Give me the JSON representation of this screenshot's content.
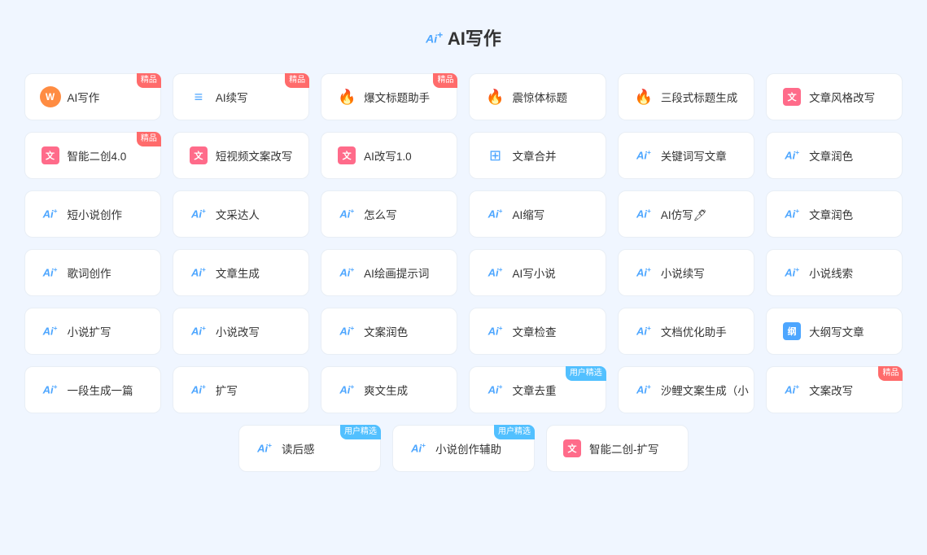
{
  "page": {
    "title": "AI写作",
    "title_prefix": "Ai+"
  },
  "rows": [
    {
      "items": [
        {
          "id": "ai-write",
          "icon_type": "special-w",
          "label": "AI写作",
          "badge": "精品",
          "badge_type": "premium"
        },
        {
          "id": "ai-continue",
          "icon_type": "special-list",
          "label": "AI续写",
          "badge": "精品",
          "badge_type": "premium"
        },
        {
          "id": "hot-title",
          "icon_type": "fire-pink",
          "label": "爆文标题助手",
          "badge": "精品",
          "badge_type": "premium"
        },
        {
          "id": "shock-title",
          "icon_type": "fire-red",
          "label": "震惊体标题",
          "badge": null
        },
        {
          "id": "three-title",
          "icon_type": "fire-orange",
          "label": "三段式标题生成",
          "badge": null
        },
        {
          "id": "article-style",
          "icon_type": "doc-red",
          "label": "文章风格改写",
          "badge": null
        }
      ]
    },
    {
      "items": [
        {
          "id": "smart-recreate",
          "icon_type": "doc-red",
          "label": "智能二创4.0",
          "badge": "精品",
          "badge_type": "premium"
        },
        {
          "id": "short-video",
          "icon_type": "doc-red",
          "label": "短视频文案改写",
          "badge": null
        },
        {
          "id": "ai-rewrite",
          "icon_type": "doc-red",
          "label": "AI改写1.0",
          "badge": null
        },
        {
          "id": "article-merge",
          "icon_type": "merge-blue",
          "label": "文章合并",
          "badge": null
        },
        {
          "id": "keyword-write",
          "icon_type": "ai-blue",
          "label": "关键词写文章",
          "badge": null
        },
        {
          "id": "article-polish1",
          "icon_type": "ai-blue",
          "label": "文章润色",
          "badge": null
        }
      ]
    },
    {
      "items": [
        {
          "id": "short-novel",
          "icon_type": "ai-blue",
          "label": "短小说创作",
          "badge": null
        },
        {
          "id": "prose-master",
          "icon_type": "ai-blue",
          "label": "文采达人",
          "badge": null
        },
        {
          "id": "how-to-write",
          "icon_type": "ai-blue",
          "label": "怎么写",
          "badge": null
        },
        {
          "id": "ai-shorten",
          "icon_type": "ai-blue",
          "label": "AI缩写",
          "badge": null
        },
        {
          "id": "ai-imitate",
          "icon_type": "ai-blue-drop",
          "label": "AI仿写🖊",
          "badge": null
        },
        {
          "id": "article-polish2",
          "icon_type": "ai-blue",
          "label": "文章润色",
          "badge": null
        }
      ]
    },
    {
      "items": [
        {
          "id": "lyric-create",
          "icon_type": "ai-blue",
          "label": "歌词创作",
          "badge": null
        },
        {
          "id": "article-gen",
          "icon_type": "ai-blue",
          "label": "文章生成",
          "badge": null
        },
        {
          "id": "ai-draw-prompt",
          "icon_type": "ai-blue",
          "label": "AI绘画提示词",
          "badge": null
        },
        {
          "id": "ai-novel-write",
          "icon_type": "ai-blue",
          "label": "AI写小说",
          "badge": null
        },
        {
          "id": "novel-continue",
          "icon_type": "ai-blue",
          "label": "小说续写",
          "badge": null
        },
        {
          "id": "novel-clue",
          "icon_type": "ai-blue",
          "label": "小说线索",
          "badge": null
        }
      ]
    },
    {
      "items": [
        {
          "id": "novel-expand",
          "icon_type": "ai-blue",
          "label": "小说扩写",
          "badge": null
        },
        {
          "id": "novel-rewrite",
          "icon_type": "ai-blue",
          "label": "小说改写",
          "badge": null
        },
        {
          "id": "copy-polish",
          "icon_type": "ai-blue",
          "label": "文案润色",
          "badge": null
        },
        {
          "id": "article-check",
          "icon_type": "ai-blue",
          "label": "文章检查",
          "badge": null
        },
        {
          "id": "doc-optimize",
          "icon_type": "ai-blue",
          "label": "文档优化助手",
          "badge": null
        },
        {
          "id": "outline-write",
          "icon_type": "outline-blue",
          "label": "大纲写文章",
          "badge": null
        }
      ]
    },
    {
      "items": [
        {
          "id": "one-para-gen",
          "icon_type": "ai-blue",
          "label": "一段生成一篇",
          "badge": null
        },
        {
          "id": "expand-write",
          "icon_type": "ai-blue",
          "label": "扩写",
          "badge": null
        },
        {
          "id": "cool-gen",
          "icon_type": "ai-blue",
          "label": "爽文生成",
          "badge": null
        },
        {
          "id": "article-dedup",
          "icon_type": "ai-blue",
          "label": "文章去重",
          "badge": "用户精选",
          "badge_type": "user"
        },
        {
          "id": "shalidi-copy",
          "icon_type": "ai-blue",
          "label": "沙鲤文案生成（小",
          "badge": null
        },
        {
          "id": "copy-rewrite",
          "icon_type": "ai-blue",
          "label": "文案改写",
          "badge": "精品",
          "badge_type": "premium"
        }
      ]
    },
    {
      "centered": true,
      "items": [
        {
          "id": "reading-review",
          "icon_type": "ai-blue",
          "label": "读后感",
          "badge": "用户精选",
          "badge_type": "user"
        },
        {
          "id": "novel-assist",
          "icon_type": "ai-blue",
          "label": "小说创作辅助",
          "badge": "用户精选",
          "badge_type": "user"
        },
        {
          "id": "smart-recreate2",
          "icon_type": "doc-red",
          "label": "智能二创-扩写",
          "badge": null
        }
      ]
    }
  ]
}
